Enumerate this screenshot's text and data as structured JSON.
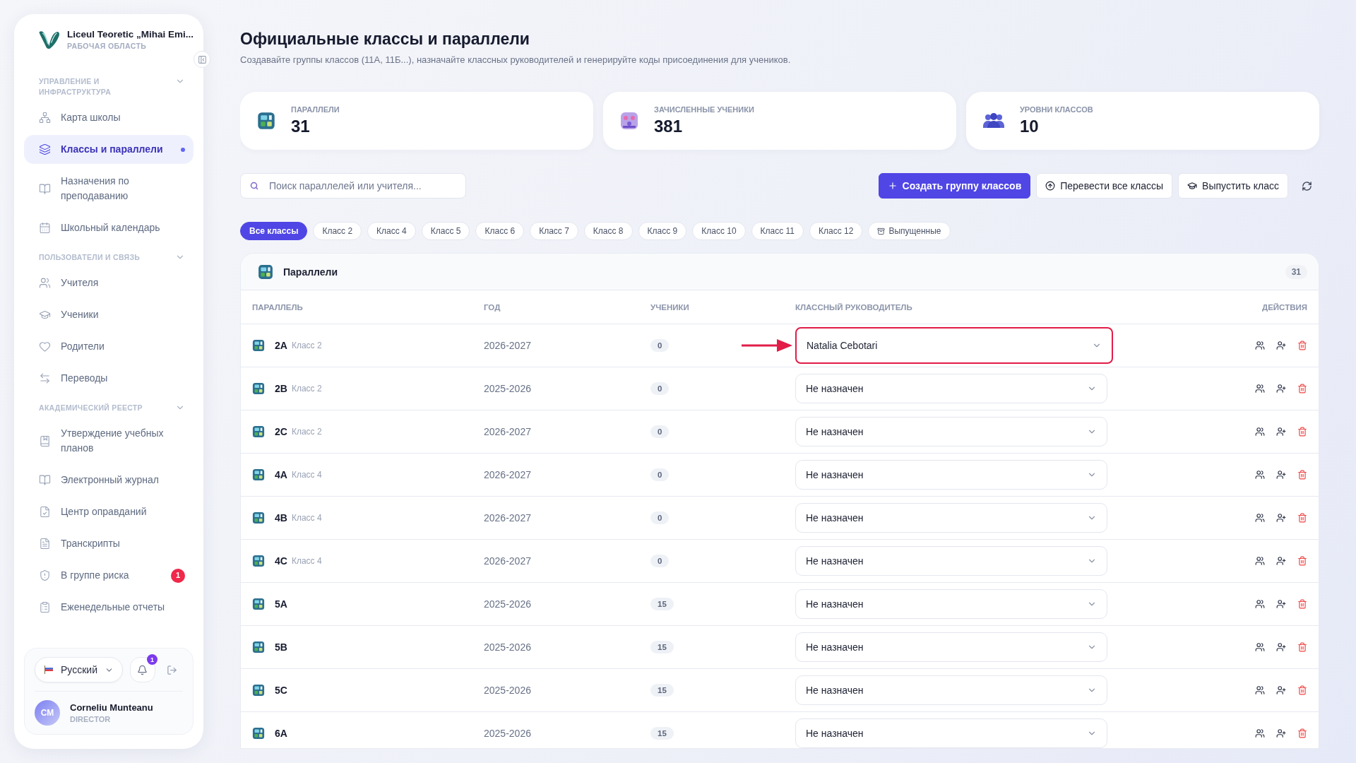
{
  "sidebar": {
    "school_name": "Liceul Teoretic „Mihai Emi...",
    "workspace": "РАБОЧАЯ ОБЛАСТЬ",
    "sections": [
      {
        "title": "УПРАВЛЕНИЕ И ИНФРАСТРУКТУРА",
        "expanded": true,
        "items": [
          {
            "label": "Карта школы",
            "selected": false
          },
          {
            "label": "Классы и параллели",
            "selected": true
          },
          {
            "label": "Назначения по преподаванию",
            "selected": false
          },
          {
            "label": "Школьный календарь",
            "selected": false
          }
        ]
      },
      {
        "title": "ПОЛЬЗОВАТЕЛИ И СВЯЗЬ",
        "expanded": true,
        "items": [
          {
            "label": "Учителя",
            "selected": false
          },
          {
            "label": "Ученики",
            "selected": false
          },
          {
            "label": "Родители",
            "selected": false
          },
          {
            "label": "Переводы",
            "selected": false
          }
        ]
      },
      {
        "title": "АКАДЕМИЧЕСКИЙ РЕЕСТР",
        "expanded": true,
        "items": [
          {
            "label": "Утверждение учебных планов",
            "selected": false
          },
          {
            "label": "Электронный журнал",
            "selected": false
          },
          {
            "label": "Центр оправданий",
            "selected": false
          },
          {
            "label": "Транскрипты",
            "selected": false
          },
          {
            "label": "В группе риска",
            "selected": false,
            "badge": "1"
          },
          {
            "label": "Еженедельные отчеты",
            "selected": false
          }
        ]
      }
    ],
    "language": "Русский",
    "notifications": "1",
    "user": {
      "initials": "CM",
      "name": "Corneliu Munteanu",
      "role": "DIRECTOR"
    }
  },
  "page": {
    "title": "Официальные классы и параллели",
    "subtitle": "Создавайте группы классов (11А, 11Б...), назначайте классных руководителей и генерируйте коды присоединения для учеников."
  },
  "stats": [
    {
      "label": "ПАРАЛЛЕЛИ",
      "value": "31"
    },
    {
      "label": "ЗАЧИСЛЕННЫЕ УЧЕНИКИ",
      "value": "381"
    },
    {
      "label": "УРОВНИ КЛАССОВ",
      "value": "10"
    }
  ],
  "search": {
    "placeholder": "Поиск параллелей или учителя..."
  },
  "actions": [
    {
      "label": "Создать группу классов",
      "kind": "primary"
    },
    {
      "label": "Перевести все классы",
      "kind": "secondary"
    },
    {
      "label": "Выпустить класс",
      "kind": "secondary"
    }
  ],
  "filters": [
    {
      "label": "Все классы",
      "selected": true,
      "kind": "grade"
    },
    {
      "label": "Класс 2",
      "selected": false,
      "kind": "grade"
    },
    {
      "label": "Класс 4",
      "selected": false,
      "kind": "grade"
    },
    {
      "label": "Класс 5",
      "selected": false,
      "kind": "grade"
    },
    {
      "label": "Класс 6",
      "selected": false,
      "kind": "grade"
    },
    {
      "label": "Класс 7",
      "selected": false,
      "kind": "grade"
    },
    {
      "label": "Класс 8",
      "selected": false,
      "kind": "grade"
    },
    {
      "label": "Класс 9",
      "selected": false,
      "kind": "grade"
    },
    {
      "label": "Класс 10",
      "selected": false,
      "kind": "grade"
    },
    {
      "label": "Класс 11",
      "selected": false,
      "kind": "grade"
    },
    {
      "label": "Класс 12",
      "selected": false,
      "kind": "grade"
    },
    {
      "label": "Выпущенные",
      "selected": false,
      "kind": "archived"
    }
  ],
  "table": {
    "title": "Параллели",
    "count": "31",
    "columns": [
      "ПАРАЛЛЕЛЬ",
      "ГОД",
      "УЧЕНИКИ",
      "КЛАССНЫЙ РУКОВОДИТЕЛЬ",
      "ДЕЙСТВИЯ"
    ],
    "rows": [
      {
        "name": "2A",
        "grade": "Класс 2",
        "year": "2026-2027",
        "students": "0",
        "teacher": "Natalia Cebotari",
        "highlighted": true
      },
      {
        "name": "2B",
        "grade": "Класс 2",
        "year": "2025-2026",
        "students": "0",
        "teacher": "Не назначен",
        "highlighted": false
      },
      {
        "name": "2C",
        "grade": "Класс 2",
        "year": "2026-2027",
        "students": "0",
        "teacher": "Не назначен",
        "highlighted": false
      },
      {
        "name": "4A",
        "grade": "Класс 4",
        "year": "2026-2027",
        "students": "0",
        "teacher": "Не назначен",
        "highlighted": false
      },
      {
        "name": "4B",
        "grade": "Класс 4",
        "year": "2026-2027",
        "students": "0",
        "teacher": "Не назначен",
        "highlighted": false
      },
      {
        "name": "4C",
        "grade": "Класс 4",
        "year": "2026-2027",
        "students": "0",
        "teacher": "Не назначен",
        "highlighted": false
      },
      {
        "name": "5A",
        "year": "2025-2026",
        "students": "15",
        "teacher": "Не назначен",
        "highlighted": false
      },
      {
        "name": "5B",
        "year": "2025-2026",
        "students": "15",
        "teacher": "Не назначен",
        "highlighted": false
      },
      {
        "name": "5C",
        "year": "2025-2026",
        "students": "15",
        "teacher": "Не назначен",
        "highlighted": false
      },
      {
        "name": "6A",
        "year": "2025-2026",
        "students": "15",
        "teacher": "Не назначен",
        "highlighted": false
      }
    ]
  }
}
